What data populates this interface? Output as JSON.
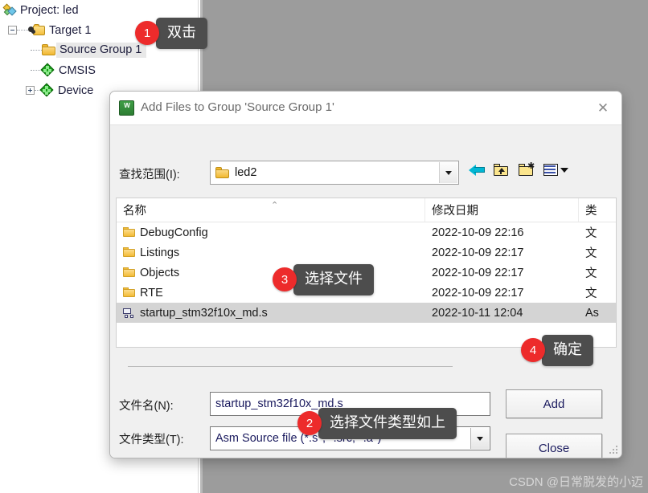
{
  "ide": {
    "tree": [
      {
        "label": "Project: led",
        "icon": "project-icon",
        "indent": 0,
        "expander": "none",
        "selected": false
      },
      {
        "label": "Target 1",
        "icon": "target-folder-icon",
        "indent": 1,
        "expander": "minus",
        "selected": false
      },
      {
        "label": "Source Group 1",
        "icon": "folder-icon",
        "indent": 2,
        "expander": "none",
        "selected": true
      },
      {
        "label": "CMSIS",
        "icon": "green-diamond-icon",
        "indent": 2,
        "expander": "none",
        "selected": false
      },
      {
        "label": "Device",
        "icon": "green-diamond-icon",
        "indent": 2,
        "expander": "plus",
        "selected": false
      }
    ]
  },
  "dialog": {
    "title": "Add Files to Group 'Source Group 1'",
    "title_icon": "keil-uvision-icon",
    "close_icon": "close-icon",
    "lookin": {
      "label": "查找范围(I):",
      "value": "led2",
      "folder_icon": "folder-icon",
      "dropdown_icon": "chevron-down-icon"
    },
    "toolbar": [
      {
        "name": "back-icon",
        "title": "后退"
      },
      {
        "name": "up-folder-icon",
        "title": "上一级"
      },
      {
        "name": "new-folder-icon",
        "title": "新建文件夹"
      },
      {
        "name": "view-mode-icon",
        "title": "视图"
      }
    ],
    "filelist": {
      "columns": [
        "名称",
        "修改日期",
        "类"
      ],
      "sort_indicator": "⌃",
      "rows": [
        {
          "name": "DebugConfig",
          "date": "2022-10-09 22:16",
          "type": "文",
          "icon": "folder-icon",
          "selected": false
        },
        {
          "name": "Listings",
          "date": "2022-10-09 22:17",
          "type": "文",
          "icon": "folder-icon",
          "selected": false
        },
        {
          "name": "Objects",
          "date": "2022-10-09 22:17",
          "type": "文",
          "icon": "folder-icon",
          "selected": false
        },
        {
          "name": "RTE",
          "date": "2022-10-09 22:17",
          "type": "文",
          "icon": "folder-icon",
          "selected": false
        },
        {
          "name": "startup_stm32f10x_md.s",
          "date": "2022-10-11 12:04",
          "type": "As",
          "icon": "asm-file-icon",
          "selected": true
        }
      ]
    },
    "form": {
      "filename_label": "文件名(N):",
      "filename_value": "startup_stm32f10x_md.s",
      "filetype_label": "文件类型(T):",
      "filetype_value": "Asm Source file (*.s*; *.src; *.a*)"
    },
    "buttons": {
      "add": "Add",
      "close": "Close"
    }
  },
  "annotations": [
    {
      "number": "1",
      "text": "双击"
    },
    {
      "number": "2",
      "text": "选择文件类型如上"
    },
    {
      "number": "3",
      "text": "选择文件"
    },
    {
      "number": "4",
      "text": "确定"
    }
  ],
  "watermark": "CSDN @日常脱发的小迈",
  "colors": {
    "badge": "#ed2b2b",
    "bubble": "#4d4d4d",
    "selection": "#d4d4d4",
    "desktop": "#9c9c9c"
  }
}
